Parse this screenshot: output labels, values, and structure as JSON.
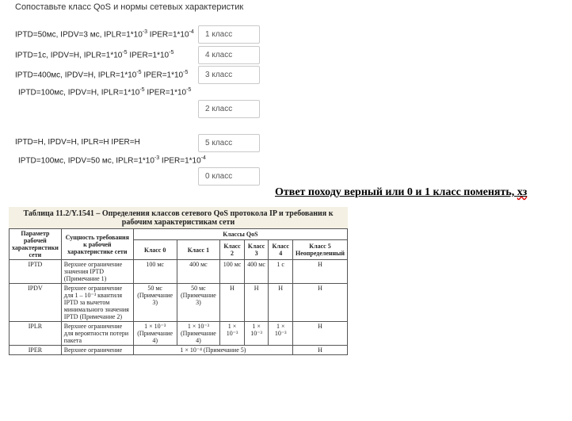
{
  "question": {
    "title": "Сопоставьте класс QoS и нормы сетевых характеристик",
    "rows": [
      {
        "label_html": "IPTD=50мс, IPDV=3 мс, IPLR=1*10<sup>-3</sup> IPER=1*10<sup>-4</sup>",
        "answer": "1 класс"
      },
      {
        "label_html": "IPTD=1с, IPDV=Н, IPLR=1*10<sup>-5</sup> IPER=1*10<sup>-5</sup>",
        "answer": "4 класс"
      },
      {
        "label_html": "IPTD=400мс, IPDV=Н, IPLR=1*10<sup>-5</sup> IPER=1*10<sup>-5</sup>",
        "answer": "3 класс"
      },
      {
        "label_html": "IPTD=100мс, IPDV=Н, IPLR=1*10<sup>-5</sup> IPER=1*10<sup>-5</sup>",
        "answer": "2 класс"
      },
      {
        "label_html": "IPTD=Н, IPDV=Н, IPLR=Н IPER=Н",
        "answer": "5 класс"
      },
      {
        "label_html": "IPTD=100мс, IPDV=50 мс, IPLR=1*10<sup>-3</sup> IPER=1*10<sup>-4</sup>",
        "answer": "0 класс"
      }
    ]
  },
  "note": {
    "text": "Ответ походу верный или 0 и 1 класс поменять, ",
    "tail": "хз"
  },
  "table": {
    "caption": "Таблица 11.2/Y.1541 – Определения классов сетевого QoS протокола IP и требования к рабочим характеристикам сети",
    "head": {
      "param": "Параметр рабочей характеристики сети",
      "essence": "Сущность требования к рабочей характеристике сети",
      "classes_title": "Классы QoS",
      "classes": [
        "Класс 0",
        "Класс 1",
        "Класс 2",
        "Класс 3",
        "Класс 4",
        "Класс 5 Неопределенный"
      ]
    },
    "rows": [
      {
        "param": "IPTD",
        "desc": "Верхнее ограничение значения IPTD (Примечание 1)",
        "vals": [
          "100 мс",
          "400 мс",
          "100 мс",
          "400 мс",
          "1 с",
          "Н"
        ]
      },
      {
        "param": "IPDV",
        "desc": "Верхнее ограничение для 1 – 10⁻³ квантиля IPTD за вычетом минимального значения IPTD (Примечание 2)",
        "vals": [
          "50 мс (Приме­чание 3)",
          "50 мс (Приме­чание 3)",
          "Н",
          "Н",
          "Н",
          "Н"
        ]
      },
      {
        "param": "IPLR",
        "desc": "Верхнее ограничение для вероятности потери пакета",
        "vals": [
          "1 × 10⁻³ (Приме­чание 4)",
          "1 × 10⁻³ (Приме­чание 4)",
          "1 × 10⁻³",
          "1 × 10⁻³",
          "1 × 10⁻³",
          "Н"
        ]
      }
    ],
    "last_row": {
      "param": "IPER",
      "desc": "Верхнее ограничение",
      "merged": "1 × 10⁻⁴ (Примечание 5)",
      "last": "Н"
    }
  }
}
